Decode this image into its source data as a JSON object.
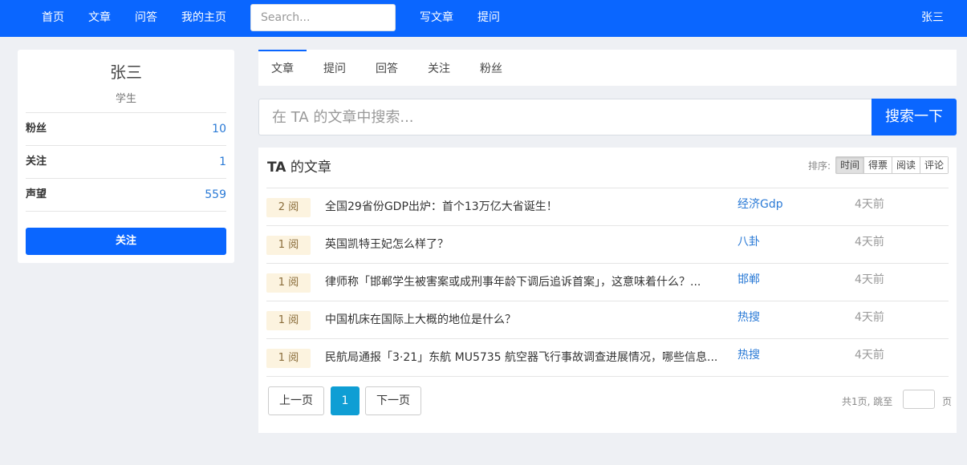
{
  "nav": {
    "links": [
      "首页",
      "文章",
      "问答",
      "我的主页"
    ],
    "search_placeholder": "Search...",
    "actions": [
      "写文章",
      "提问"
    ],
    "user": "张三"
  },
  "profile": {
    "name": "张三",
    "role": "学生",
    "stats": [
      {
        "label": "粉丝",
        "value": "10"
      },
      {
        "label": "关注",
        "value": "1"
      },
      {
        "label": "声望",
        "value": "559"
      }
    ],
    "follow_label": "关注"
  },
  "tabs": [
    "文章",
    "提问",
    "回答",
    "关注",
    "粉丝"
  ],
  "article_search": {
    "placeholder": "在 TA 的文章中搜索...",
    "button": "搜索一下"
  },
  "articles": {
    "title_bold": "TA",
    "title_rest": " 的文章",
    "sort_label": "排序:",
    "sort_options": [
      "时间",
      "得票",
      "阅读",
      "评论"
    ],
    "active_sort": "时间",
    "items": [
      {
        "reads": "2 阅",
        "title": "全国29省份GDP出炉：首个13万亿大省诞生！",
        "tag": "经济Gdp",
        "time": "4天前"
      },
      {
        "reads": "1 阅",
        "title": "英国凯特王妃怎么样了？",
        "tag": "八卦",
        "time": "4天前"
      },
      {
        "reads": "1 阅",
        "title": "律师称「邯郸学生被害案或成刑事年龄下调后追诉首案」，这意味着什么？...",
        "tag": "邯郸",
        "time": "4天前"
      },
      {
        "reads": "1 阅",
        "title": "中国机床在国际上大概的地位是什么？",
        "tag": "热搜",
        "time": "4天前"
      },
      {
        "reads": "1 阅",
        "title": "民航局通报「3·21」东航 MU5735 航空器飞行事故调查进展情况，哪些信息...",
        "tag": "热搜",
        "time": "4天前"
      }
    ]
  },
  "pagination": {
    "prev": "上一页",
    "current": "1",
    "next": "下一页",
    "info": "共1页, 跳至",
    "suffix": "页"
  },
  "colors": {
    "brand": "#0a66ff",
    "link": "#2a7ad6",
    "pager_active": "#0f9ed4",
    "read_badge_bg": "#fcf3df"
  }
}
